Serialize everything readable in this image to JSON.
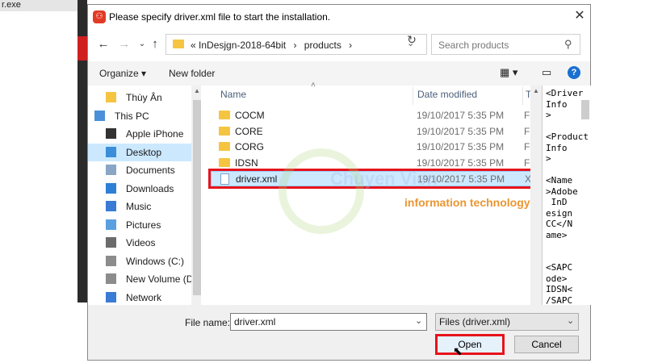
{
  "background": {
    "exe_label": "r.exe"
  },
  "dialog": {
    "title": "Please specify driver.xml file to start the installation.",
    "breadcrumb": [
      "«",
      "InDesjgn-2018-64bit",
      "›",
      "products",
      "›"
    ],
    "search_placeholder": "Search products",
    "toolbar": {
      "organize": "Organize ▾",
      "new_folder": "New folder"
    },
    "nav_items": [
      {
        "label": "Thùy Ân",
        "icon": "folder-icon"
      },
      {
        "label": "This PC",
        "icon": "computer-icon"
      },
      {
        "label": "Apple iPhone",
        "icon": "phone-icon"
      },
      {
        "label": "Desktop",
        "icon": "desktop-icon",
        "selected": true
      },
      {
        "label": "Documents",
        "icon": "documents-icon"
      },
      {
        "label": "Downloads",
        "icon": "download-icon"
      },
      {
        "label": "Music",
        "icon": "music-icon"
      },
      {
        "label": "Pictures",
        "icon": "pictures-icon"
      },
      {
        "label": "Videos",
        "icon": "videos-icon"
      },
      {
        "label": "Windows (C:)",
        "icon": "drive-icon"
      },
      {
        "label": "New Volume (D:",
        "icon": "drive-icon"
      },
      {
        "label": "Network",
        "icon": "network-icon"
      }
    ],
    "columns": {
      "name": "Name",
      "date": "Date modified",
      "type": "Typ"
    },
    "files": [
      {
        "name": "COCM",
        "date": "19/10/2017 5:35 PM",
        "type": "File",
        "kind": "folder"
      },
      {
        "name": "CORE",
        "date": "19/10/2017 5:35 PM",
        "type": "File",
        "kind": "folder"
      },
      {
        "name": "CORG",
        "date": "19/10/2017 5:35 PM",
        "type": "File",
        "kind": "folder"
      },
      {
        "name": "IDSN",
        "date": "19/10/2017 5:35 PM",
        "type": "File",
        "kind": "folder"
      },
      {
        "name": "driver.xml",
        "date": "19/10/2017 5:35 PM",
        "type": "XM",
        "kind": "xml",
        "selected": true
      }
    ],
    "preview_text": "<Driver\nInfo\n>\n\n<Product\nInfo\n>\n\n<Name\n>Adobe\n InD\nesign\nCC</N\name>\n\n\n<SAPC\node>\nIDSN<\n/SAPC\node>",
    "file_name_label": "File name:",
    "file_name_value": "driver.xml",
    "file_type_value": "Files (driver.xml)",
    "open_label": "Open",
    "cancel_label": "Cancel"
  },
  "watermark": {
    "line1": "Chuyen Vien",
    "line2": "information technology"
  },
  "colors": {
    "accent": "#e8131b",
    "selection": "#cce8ff",
    "folder": "#f5c542"
  }
}
